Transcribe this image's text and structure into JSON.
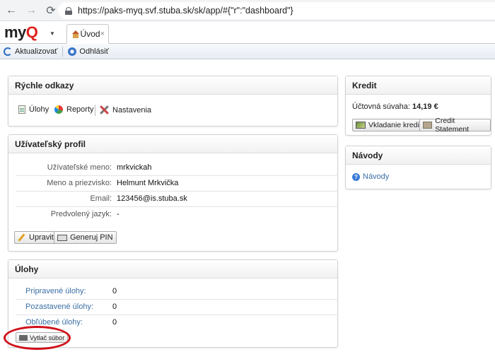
{
  "browser": {
    "url": "https://paks-myq.svf.stuba.sk/sk/app/#{\"r\":\"dashboard\"}"
  },
  "app": {
    "logo_text": "my",
    "logo_accent": "Q",
    "tab_label": "Úvod",
    "tab_close": "×"
  },
  "toolbar": {
    "refresh_label": "Aktualizovať",
    "logout_label": "Odhlásiť"
  },
  "quick_links": {
    "title": "Rýchle odkazy",
    "items": [
      {
        "label": "Úlohy",
        "icon": "document-icon"
      },
      {
        "label": "Reporty",
        "icon": "pie-chart-icon"
      },
      {
        "label": "Nastavenia",
        "icon": "tools-icon"
      }
    ]
  },
  "profile": {
    "title": "Užívateľský profil",
    "fields": [
      {
        "label": "Užívateľské meno:",
        "value": "mrkvickah"
      },
      {
        "label": "Meno a priezvisko:",
        "value": "Helmunt Mrkvička"
      },
      {
        "label": "Email:",
        "value": "123456@is.stuba.sk"
      },
      {
        "label": "Predvolený jazyk:",
        "value": "-"
      }
    ],
    "edit_button": "Upraviť",
    "pin_button": "Generuj PIN"
  },
  "jobs": {
    "title": "Úlohy",
    "rows": [
      {
        "label": "Pripravené úlohy:",
        "value": "0"
      },
      {
        "label": "Pozastavené úlohy:",
        "value": "0"
      },
      {
        "label": "Obľúbené úlohy:",
        "value": "0"
      }
    ],
    "print_button": "Vytlač súbor"
  },
  "credit": {
    "title": "Kredit",
    "balance_label": "Účtovná súvaha:",
    "balance_value": "14,19 €",
    "deposit_button": "Vkladanie kreditu",
    "statement_button": "Credit Statement"
  },
  "guides": {
    "title": "Návody",
    "link": "Návody"
  },
  "colors": {
    "accent": "#e2211c",
    "link": "#3a6ea5",
    "highlight": "#d0101a"
  }
}
